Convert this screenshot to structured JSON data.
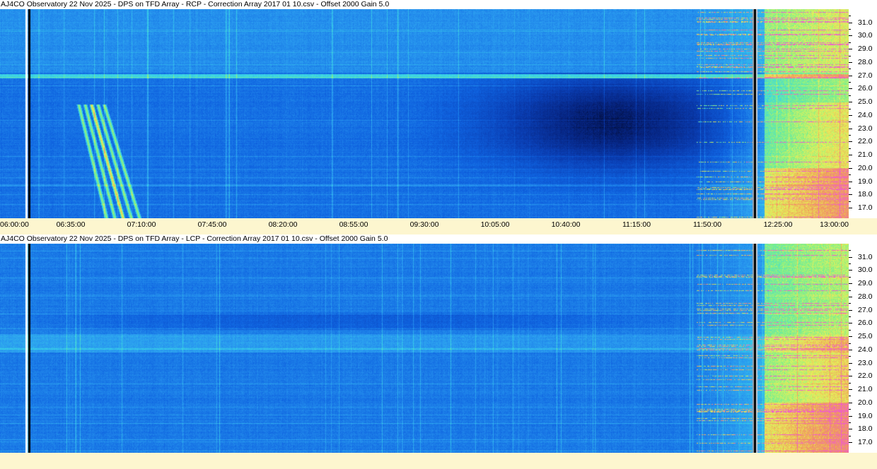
{
  "panels": [
    {
      "title": "AJ4CO Observatory 22 Nov 2025  -  DPS on TFD Array  -  RCP  -  Correction Array 2017 01 10.csv  -  Offset 2000  Gain 5.0",
      "polarization": "RCP"
    },
    {
      "title": "AJ4CO Observatory 22 Nov 2025  -  DPS on TFD Array  -  LCP  -  Correction Array 2017 01 10.csv  -  Offset 2000  Gain 5.0",
      "polarization": "LCP"
    }
  ],
  "chart_data": {
    "type": "heatmap",
    "x_tick_labels": [
      "06:00:00",
      "06:35:00",
      "07:10:00",
      "07:45:00",
      "08:20:00",
      "08:55:00",
      "09:30:00",
      "10:05:00",
      "10:40:00",
      "11:15:00",
      "11:50:00",
      "12:25:00",
      "13:00:00"
    ],
    "y_tick_labels": [
      "31.0",
      "30.0",
      "29.0",
      "28.0",
      "27.0",
      "26.0",
      "25.0",
      "24.0",
      "23.0",
      "22.0",
      "21.0",
      "20.0",
      "19.0",
      "18.0",
      "17.0"
    ],
    "x_range": [
      "06:00:00",
      "13:00:00"
    ],
    "y_range": [
      16.2,
      32.0
    ],
    "y_axis_position": "right",
    "colormap": [
      "#000010",
      "#06237e",
      "#0a3fb5",
      "#0f63e0",
      "#2a9bf0",
      "#3ad6e6",
      "#7cf08a",
      "#e8f05a",
      "#f09a5a",
      "#f05ad0"
    ]
  }
}
